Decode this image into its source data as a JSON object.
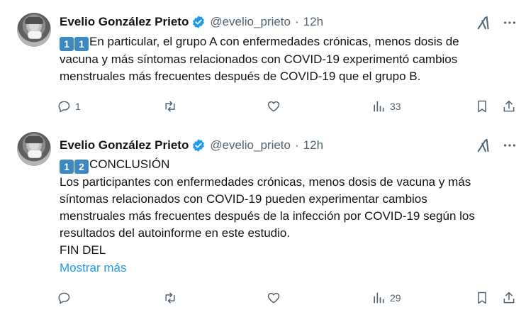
{
  "tweets": [
    {
      "author_name": "Evelio González Prieto",
      "handle": "@evelio_prieto",
      "separator": "·",
      "time": "12h",
      "keycaps": [
        "1",
        "1"
      ],
      "lines": [
        "En particular, el grupo A con enfermedades crónicas, menos dosis de",
        "vacuna y más síntomas relacionados con COVID-19 experimentó cambios",
        "menstruales más frecuentes después de COVID-19 que el grupo B."
      ],
      "reply_count": "1",
      "retweet_count": "",
      "like_count": "",
      "views_count": "33"
    },
    {
      "author_name": "Evelio González Prieto",
      "handle": "@evelio_prieto",
      "separator": "·",
      "time": "12h",
      "keycaps": [
        "1",
        "2"
      ],
      "lines": [
        "CONCLUSIÓN",
        "Los participantes con enfermedades crónicas, menos dosis de vacuna y más",
        "síntomas relacionados con COVID-19 pueden experimentar cambios",
        "menstruales más frecuentes después de la infección por COVID-19 según los",
        "resultados del autoinforme en este estudio.",
        "FIN DEL"
      ],
      "show_more": "Mostrar más",
      "reply_count": "",
      "retweet_count": "",
      "like_count": "",
      "views_count": "29"
    }
  ],
  "colors": {
    "accent": "#1d9bf0",
    "muted": "#536471",
    "text": "#0f1419",
    "keycap": "#3b88c3"
  },
  "icons": [
    "verified-badge-icon",
    "grok-icon",
    "more-icon",
    "reply-icon",
    "retweet-icon",
    "like-icon",
    "views-icon",
    "bookmark-icon",
    "share-icon"
  ]
}
